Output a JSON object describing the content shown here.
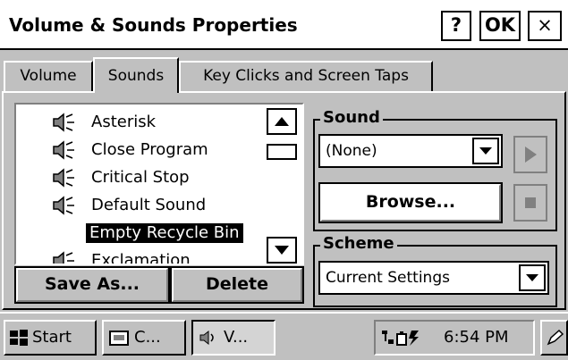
{
  "window": {
    "title": "Volume & Sounds Properties",
    "help_label": "?",
    "ok_label": "OK",
    "close_label": "×"
  },
  "tabs": [
    {
      "label": "Volume",
      "active": false
    },
    {
      "label": "Sounds",
      "active": true
    },
    {
      "label": "Key Clicks and Screen Taps",
      "active": false
    }
  ],
  "events": [
    {
      "label": "Asterisk",
      "has_sound": true,
      "selected": false
    },
    {
      "label": "Close Program",
      "has_sound": true,
      "selected": false
    },
    {
      "label": "Critical Stop",
      "has_sound": true,
      "selected": false
    },
    {
      "label": "Default Sound",
      "has_sound": true,
      "selected": false
    },
    {
      "label": "Empty Recycle Bin",
      "has_sound": false,
      "selected": true
    },
    {
      "label": "Exclamation",
      "has_sound": true,
      "selected": false
    }
  ],
  "buttons": {
    "save_as": "Save As...",
    "delete": "Delete",
    "browse": "Browse..."
  },
  "sound_group": {
    "legend": "Sound",
    "selected": "(None)"
  },
  "scheme_group": {
    "legend": "Scheme",
    "selected": "Current Settings"
  },
  "taskbar": {
    "start_label": "Start",
    "task1_label": "C...",
    "task2_label": "V...",
    "clock": "6:54 PM"
  }
}
